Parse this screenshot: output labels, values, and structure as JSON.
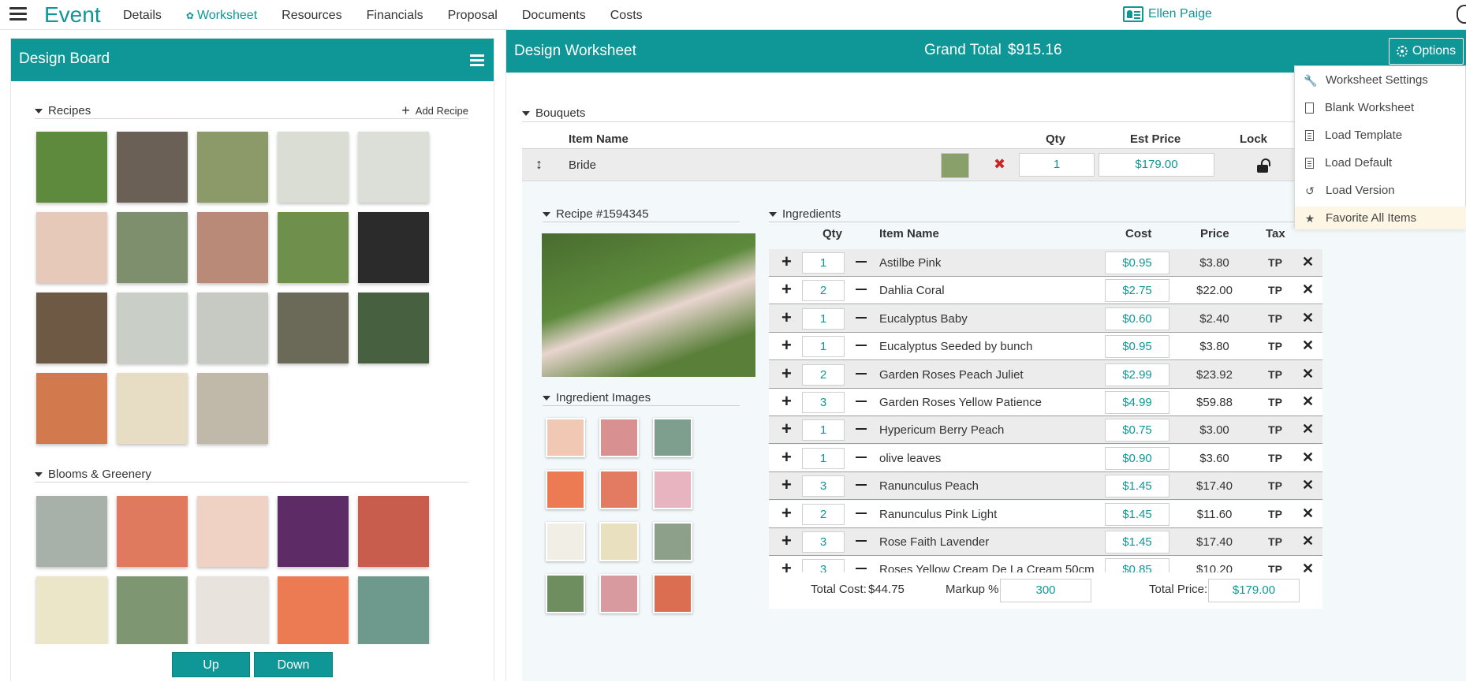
{
  "nav": {
    "brand": "Event",
    "links": [
      "Details",
      "Worksheet",
      "Resources",
      "Financials",
      "Proposal",
      "Documents",
      "Costs"
    ],
    "active": "Worksheet",
    "user": "Ellen Paige"
  },
  "design_board": {
    "title": "Design Board",
    "recipes_label": "Recipes",
    "add_recipe_label": "Add Recipe",
    "blooms_label": "Blooms & Greenery",
    "up_label": "Up",
    "down_label": "Down",
    "recipe_thumbs": [
      "#5d8a3c",
      "#6a6055",
      "#8c9a6a",
      "#d9ddd4",
      "#dcdfd8",
      "#e6c9b8",
      "#7e8f6e",
      "#b98a78",
      "#6f8f4c",
      "#2b2b2b",
      "#6e5a44",
      "#c9cfc6",
      "#c7c9c3",
      "#6b6a59",
      "#476040",
      "#d2794d",
      "#e7dcc4",
      "#c0b8a8"
    ],
    "bloom_thumbs": [
      "#a8b0aa",
      "#df7a5e",
      "#efd2c4",
      "#5d2c66",
      "#c85c4d",
      "#ece6c8",
      "#7f9673",
      "#e8e3dc",
      "#ec7a52",
      "#6e9a8e"
    ]
  },
  "worksheet": {
    "title": "Design Worksheet",
    "grand_total_label": "Grand Total",
    "grand_total_value": "$915.16",
    "options_label": "Options",
    "bouquets_label": "Bouquets",
    "columns": {
      "item_name": "Item Name",
      "qty": "Qty",
      "est_price": "Est Price",
      "lock": "Lock"
    },
    "item": {
      "name": "Bride",
      "qty": "1",
      "est_price": "$179.00"
    },
    "recipe_label": "Recipe #1594345",
    "ingredient_images_label": "Ingredient Images",
    "ingredient_images": [
      "#f1c8b4",
      "#d99090",
      "#7e9e8e",
      "#ec7a52",
      "#e37a62",
      "#e7b4bf",
      "#f1efe5",
      "#e9e0c0",
      "#8ca08a",
      "#6f8e5f",
      "#d89a9e",
      "#db6e50"
    ],
    "ingredients_label": "Ingredients",
    "ing_columns": {
      "qty": "Qty",
      "item_name": "Item Name",
      "cost": "Cost",
      "price": "Price",
      "tax": "Tax"
    },
    "ingredients": [
      {
        "qty": "1",
        "name": "Astilbe Pink",
        "cost": "$0.95",
        "price": "$3.80",
        "tax": "TP"
      },
      {
        "qty": "2",
        "name": "Dahlia Coral",
        "cost": "$2.75",
        "price": "$22.00",
        "tax": "TP"
      },
      {
        "qty": "1",
        "name": "Eucalyptus Baby",
        "cost": "$0.60",
        "price": "$2.40",
        "tax": "TP"
      },
      {
        "qty": "1",
        "name": "Eucalyptus Seeded by bunch",
        "cost": "$0.95",
        "price": "$3.80",
        "tax": "TP"
      },
      {
        "qty": "2",
        "name": "Garden Roses Peach Juliet",
        "cost": "$2.99",
        "price": "$23.92",
        "tax": "TP"
      },
      {
        "qty": "3",
        "name": "Garden Roses Yellow Patience",
        "cost": "$4.99",
        "price": "$59.88",
        "tax": "TP"
      },
      {
        "qty": "1",
        "name": "Hypericum Berry Peach",
        "cost": "$0.75",
        "price": "$3.00",
        "tax": "TP"
      },
      {
        "qty": "1",
        "name": "olive leaves",
        "cost": "$0.90",
        "price": "$3.60",
        "tax": "TP"
      },
      {
        "qty": "3",
        "name": "Ranunculus Peach",
        "cost": "$1.45",
        "price": "$17.40",
        "tax": "TP"
      },
      {
        "qty": "2",
        "name": "Ranunculus Pink Light",
        "cost": "$1.45",
        "price": "$11.60",
        "tax": "TP"
      },
      {
        "qty": "3",
        "name": "Rose Faith Lavender",
        "cost": "$1.45",
        "price": "$17.40",
        "tax": "TP"
      },
      {
        "qty": "3",
        "name": "Roses Yellow Cream De La Cream 50cm",
        "cost": "$0.85",
        "price": "$10.20",
        "tax": "TP"
      }
    ],
    "totals": {
      "total_cost_label": "Total Cost:",
      "total_cost": "$44.75",
      "markup_label": "Markup %",
      "markup": "300",
      "total_price_label": "Total Price:",
      "total_price": "$179.00"
    }
  },
  "options_menu": {
    "items": [
      "Worksheet Settings",
      "Blank Worksheet",
      "Load Template",
      "Load Default",
      "Load Version",
      "Favorite All Items"
    ],
    "highlighted": "Favorite All Items"
  },
  "colors": {
    "accent": "#0f9797",
    "delete": "#c62828",
    "highlight": "#fef6e4"
  }
}
